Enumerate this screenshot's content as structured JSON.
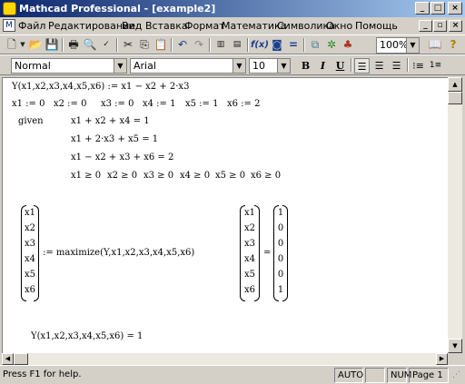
{
  "window": {
    "title": "Mathcad Professional - [example2]",
    "controls": {
      "minimize": "_",
      "maximize": "□",
      "close": "×"
    }
  },
  "menubar": {
    "items": [
      "Файл",
      "Редактирование",
      "Вид",
      "Вставка",
      "Формат",
      "Математика",
      "Символика",
      "Окно",
      "Помощь"
    ],
    "mdi_controls": {
      "minimize": "_",
      "restore": "▫",
      "close": "×"
    }
  },
  "toolbar": {
    "icons": [
      "new-icon",
      "open-icon",
      "save-icon",
      "print-icon",
      "print-preview-icon",
      "spell-check-icon",
      "cut-icon",
      "copy-icon",
      "paste-icon",
      "undo-icon",
      "redo-icon",
      "align-horizontal-icon",
      "align-vertical-icon",
      "insert-function-icon",
      "insert-unit-icon",
      "calculate-icon",
      "component-icon",
      "resource-icon",
      "hierarchy-icon"
    ],
    "zoom": "100%"
  },
  "format_bar": {
    "style": "Normal",
    "font": "Arial",
    "size": "10",
    "bold": "B",
    "italic": "I",
    "underline": "U"
  },
  "worksheet": {
    "func_def": "Y(x1,x2,x3,x4,x5,x6) := x1 − x2 + 2·x3",
    "init_vars": [
      "x1 := 0",
      "x2 := 0",
      "x3 := 0",
      "x4 := 1",
      "x5 := 1",
      "x6 := 2"
    ],
    "given": "given",
    "constraints": [
      "x1 + x2 + x4 = 1",
      "x1 + 2·x3 + x5 = 1",
      "x1 − x2 + x3 + x6 = 2"
    ],
    "nonneg": [
      "x1 ≥ 0",
      "x2 ≥ 0",
      "x3 ≥ 0",
      "x4 ≥ 0",
      "x5 ≥ 0",
      "x6 ≥ 0"
    ],
    "lhs_vector": [
      "x1",
      "x2",
      "x3",
      "x4",
      "x5",
      "x6"
    ],
    "maximize_expr": ":= maximize(Y,x1,x2,x3,x4,x5,x6)",
    "result_vars": [
      "x1",
      "x2",
      "x3",
      "x4",
      "x5",
      "x6"
    ],
    "equals": "=",
    "result_values": [
      "1",
      "0",
      "0",
      "0",
      "0",
      "1"
    ],
    "final_eval": "Y(x1,x2,x3,x4,x5,x6) = 1"
  },
  "statusbar": {
    "help": "Press F1 for help.",
    "auto": "AUTO",
    "num": "NUM",
    "page": "Page 1"
  }
}
